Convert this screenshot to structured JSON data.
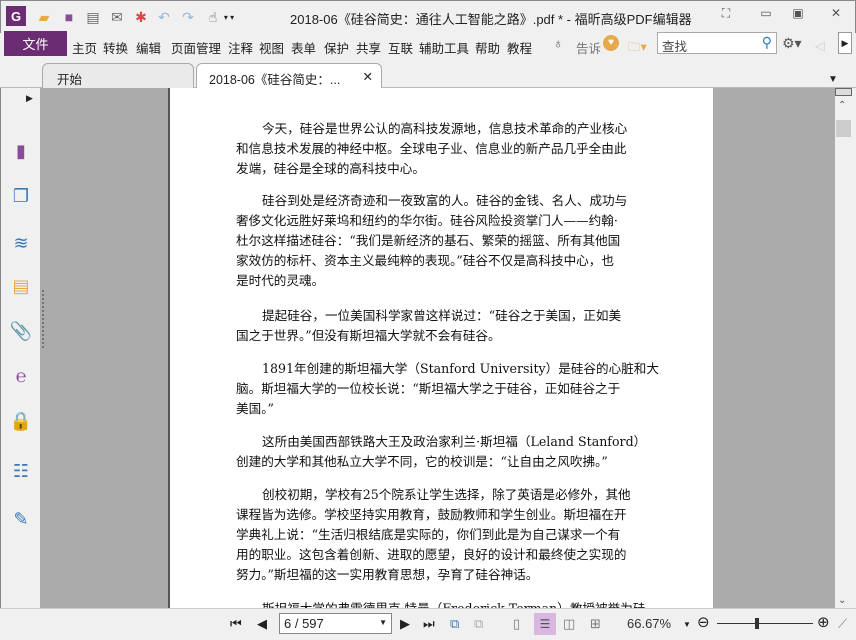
{
  "window": {
    "title": "2018-06《硅谷简史：通往人工智能之路》.pdf * - 福昕高级PDF编辑器"
  },
  "menu": {
    "file": "文件",
    "items": [
      "主页",
      "转换",
      "编辑",
      "页面管理",
      "注释",
      "视图",
      "表单",
      "保护",
      "共享",
      "互联",
      "辅助工具",
      "帮助",
      "教程"
    ],
    "tell": "告诉"
  },
  "search": {
    "placeholder": "查找"
  },
  "tabs": [
    {
      "label": "开始"
    },
    {
      "label": "2018-06《硅谷简史：..."
    }
  ],
  "document": {
    "paragraphs": [
      [
        "今天，硅谷是世界公认的高科技发源地，信息技术革命的产业核心",
        "和信息技术发展的神经中枢。全球电子业、信息业的新产品几乎全由此",
        "发端，硅谷是全球的高科技中心。"
      ],
      [
        "硅谷到处是经济奇迹和一夜致富的人。硅谷的金钱、名人、成功与",
        "奢侈文化远胜好莱坞和纽约的华尔街。硅谷风险投资掌门人——约翰·",
        "杜尔这样描述硅谷：“我们是新经济的基石、繁荣的摇篮、所有其他国",
        "家效仿的标杆、资本主义最纯粹的表现。”硅谷不仅是高科技中心，也",
        "是时代的灵魂。"
      ],
      [
        "提起硅谷，一位美国科学家曾这样说过：“硅谷之于美国，正如美",
        "国之于世界。”但没有斯坦福大学就不会有硅谷。"
      ],
      [
        "1891年创建的斯坦福大学（Stanford University）是硅谷的心脏和大",
        "脑。斯坦福大学的一位校长说：“斯坦福大学之于硅谷，正如硅谷之于",
        "美国。”"
      ],
      [
        "这所由美国西部铁路大王及政治家利兰·斯坦福（Leland Stanford）",
        "创建的大学和其他私立大学不同，它的校训是：“让自由之风吹拂。”"
      ],
      [
        "创校初期，学校有25个院系让学生选择，除了英语是必修外，其他",
        "课程皆为选修。学校坚持实用教育，鼓励教师和学生创业。斯坦福在开",
        "学典礼上说：“生活归根结底是实际的，你们到此是为自己谋求一个有",
        "用的职业。这包含着创新、进取的愿望，良好的设计和最终使之实现的",
        "努力。”斯坦福的这一实用教育思想，孕育了硅谷神话。"
      ],
      [
        "斯坦福大学的弗雷德里克·特曼（Frederick Terman）教授被誉为硅"
      ]
    ]
  },
  "status": {
    "page": "6 / 597",
    "zoom": "66.67%",
    "zoom_fraction": 0.6667
  },
  "colors": {
    "accent": "#6b2c73",
    "viewer_bg": "#ababab"
  }
}
